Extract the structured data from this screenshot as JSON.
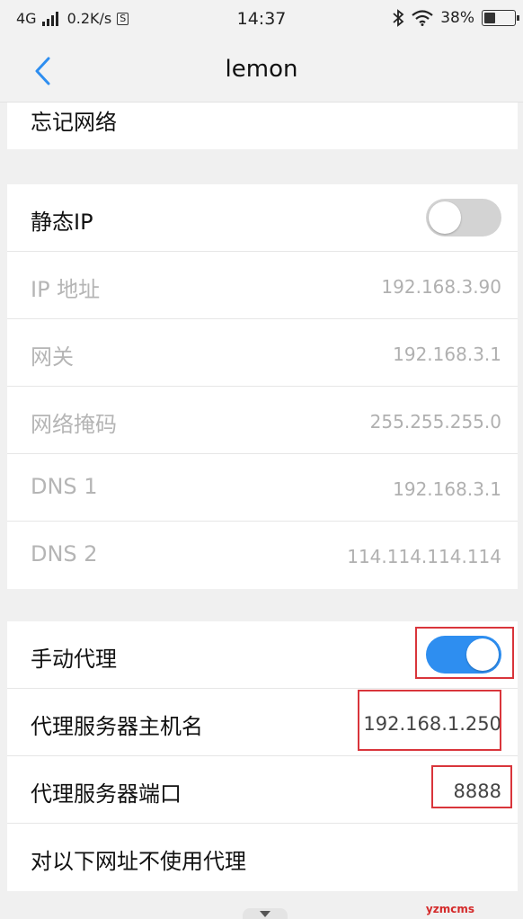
{
  "status_bar": {
    "network": "4G",
    "speed": "0.2K/s",
    "s_badge": "S",
    "time": "14:37",
    "battery": "38%",
    "battery_level": 0.38
  },
  "nav": {
    "back_icon": "chevron-left-icon",
    "title": "lemon"
  },
  "top_section": {
    "forget_network": "忘记网络"
  },
  "ip_section": {
    "static_ip": {
      "label": "静态IP",
      "enabled": false
    },
    "rows": [
      {
        "label": "IP 地址",
        "value": "192.168.3.90"
      },
      {
        "label": "网关",
        "value": "192.168.3.1"
      },
      {
        "label": "网络掩码",
        "value": "255.255.255.0"
      },
      {
        "label": "DNS 1",
        "value": "192.168.3.1"
      },
      {
        "label": "DNS 2",
        "value": "114.114.114.114"
      }
    ]
  },
  "proxy_section": {
    "manual_proxy": {
      "label": "手动代理",
      "enabled": true
    },
    "host": {
      "label": "代理服务器主机名",
      "value": "192.168.1.250"
    },
    "port": {
      "label": "代理服务器端口",
      "value": "8888"
    },
    "bypass": {
      "label": "对以下网址不使用代理"
    }
  },
  "colors": {
    "toggle_on": "#2e8ef0",
    "highlight_box": "#d9353b"
  },
  "watermark": "yzmcms"
}
